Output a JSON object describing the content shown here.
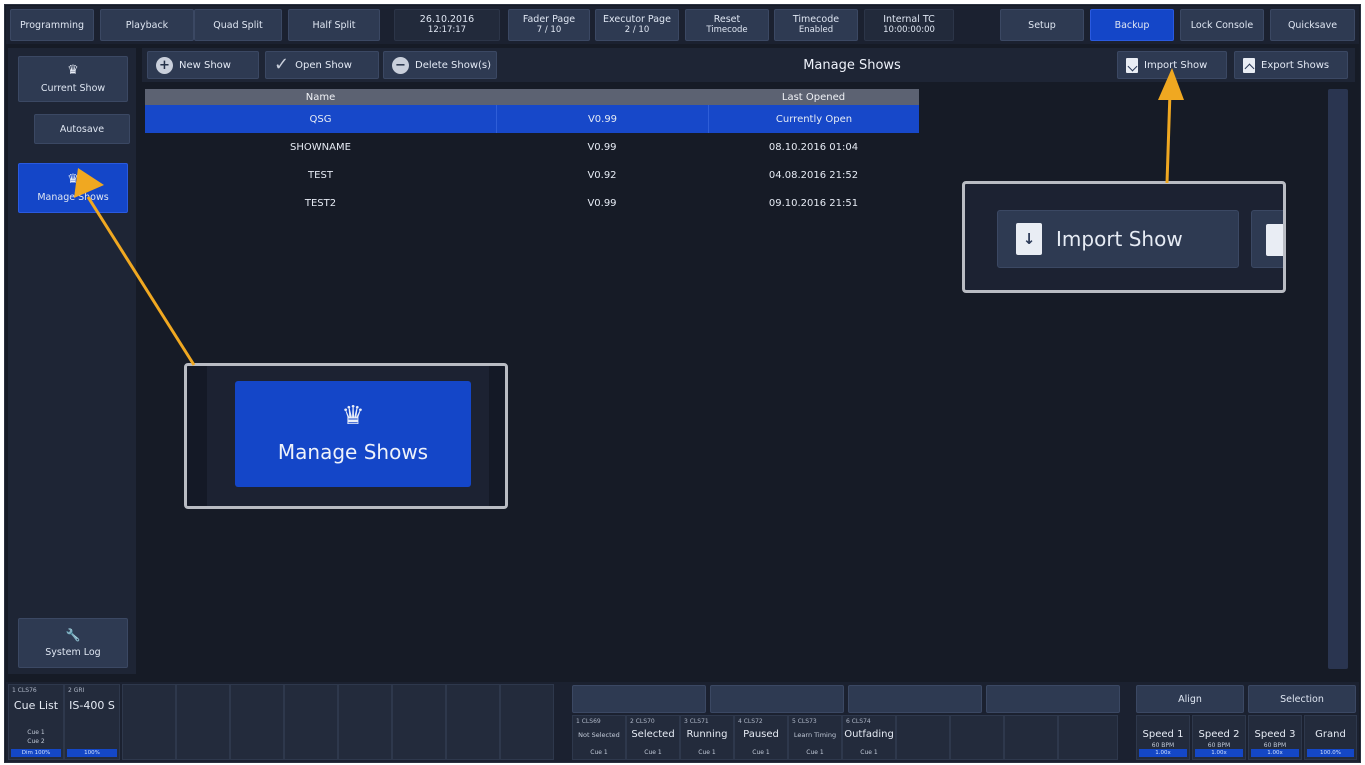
{
  "topbar": {
    "programming": "Programming",
    "playback": "Playback",
    "quad_split": "Quad Split",
    "half_split": "Half Split",
    "date": "26.10.2016",
    "time": "12:17:17",
    "fader_page_label": "Fader Page",
    "fader_page_value": "7 / 10",
    "executor_page_label": "Executor Page",
    "executor_page_value": "2 / 10",
    "reset_label": "Reset",
    "reset_sub": "Timecode",
    "timecode_label": "Timecode",
    "timecode_sub": "Enabled",
    "internal_tc_label": "Internal TC",
    "internal_tc_value": "10:00:00:00",
    "setup": "Setup",
    "backup": "Backup",
    "lock_console": "Lock Console",
    "quicksave": "Quicksave"
  },
  "sidebar": {
    "current_show": "Current Show",
    "autosave": "Autosave",
    "manage_shows": "Manage Shows",
    "system_log": "System Log"
  },
  "toolbar": {
    "new_show": "New Show",
    "open_show": "Open Show",
    "delete_shows": "Delete Show(s)",
    "title": "Manage Shows",
    "import_show": "Import Show",
    "export_shows": "Export Shows"
  },
  "table": {
    "headers": [
      "Name",
      "",
      "Last Opened"
    ],
    "rows": [
      {
        "name": "QSG",
        "version": "V0.99",
        "opened": "Currently Open"
      },
      {
        "name": "SHOWNAME",
        "version": "V0.99",
        "opened": "08.10.2016 01:04"
      },
      {
        "name": "TEST",
        "version": "V0.92",
        "opened": "04.08.2016 21:52"
      },
      {
        "name": "TEST2",
        "version": "V0.99",
        "opened": "09.10.2016 21:51"
      }
    ]
  },
  "callouts": {
    "import_show": "Import Show",
    "manage_shows": "Manage Shows"
  },
  "executors": {
    "ex1_num": "1      CLS76",
    "ex1_label": "Cue List",
    "ex1_cue1": "Cue 1",
    "ex1_cue2": "Cue 2",
    "ex1_foot": "Dim 100%",
    "ex2_num": "2           GRI",
    "ex2_label": "IS-400 S",
    "ex2_foot": "100%",
    "pb1_num": "1      CLS69",
    "pb1_label": "Not Selected",
    "pb1_cue": "Cue 1",
    "pb2_num": "2       CLS70",
    "pb2_label": "Selected",
    "pb2_cue": "Cue 1",
    "pb3_num": "3       CLS71",
    "pb3_label": "Running",
    "pb3_cue": "Cue 1",
    "pb4_num": "4       CLS72",
    "pb4_label": "Paused",
    "pb4_cue": "Cue 1",
    "pb5_num": "5       CLS73",
    "pb5_label": "Learn Timing",
    "pb5_cue": "Cue 1",
    "pb6_num": "6       CLS74",
    "pb6_label": "Outfading",
    "pb6_cue": "Cue 1",
    "align": "Align",
    "selection": "Selection",
    "speed1": "Speed 1",
    "speed2": "Speed 2",
    "speed3": "Speed 3",
    "grand": "Grand",
    "bpm": "60 BPM",
    "speed_foot": "1.00x",
    "grand_foot": "100.0%"
  }
}
